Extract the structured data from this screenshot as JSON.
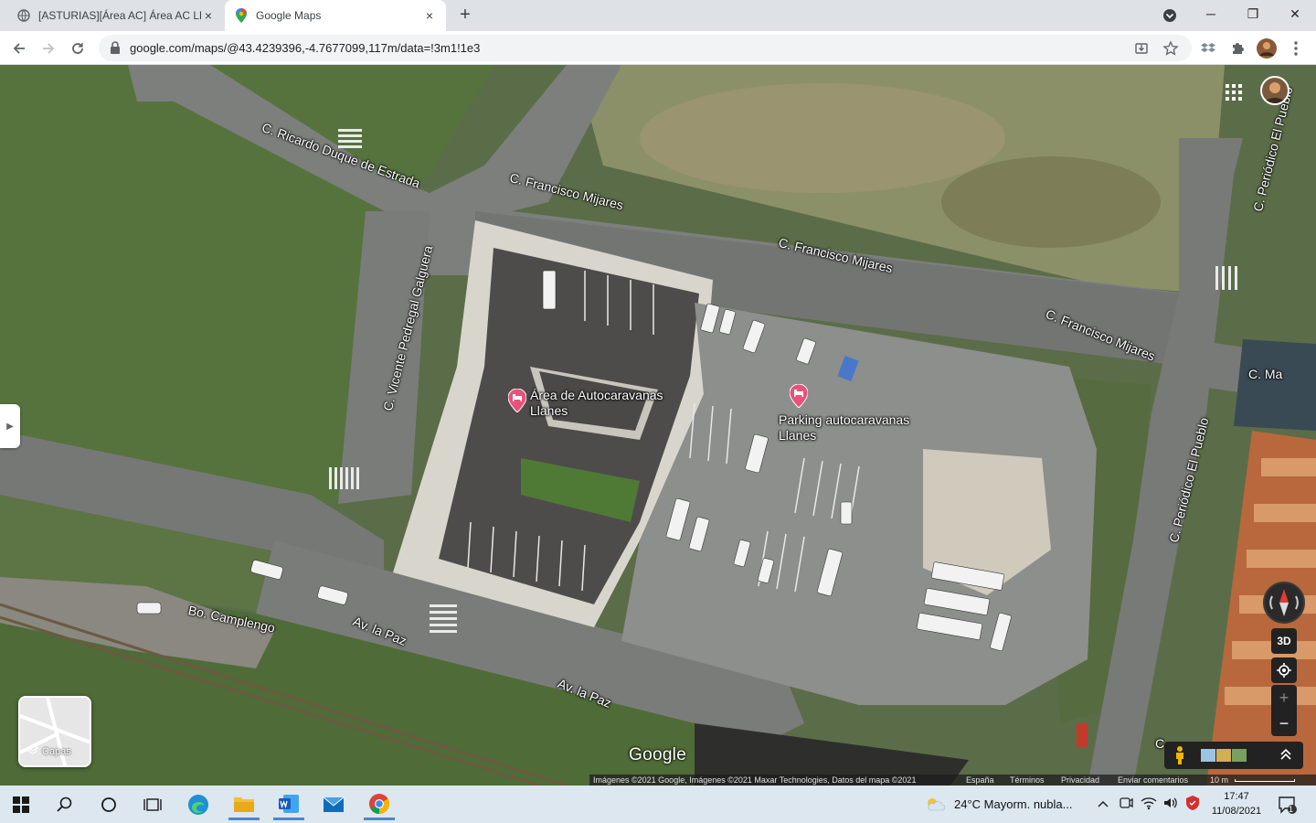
{
  "browser": {
    "tabs": [
      {
        "title": "[ASTURIAS][Área AC] Área AC Lla",
        "close": "×"
      },
      {
        "title": "Google Maps",
        "close": "×"
      }
    ],
    "new_tab": "+",
    "url": "google.com/maps/@43.4239396,-4.7677099,117m/data=!3m1!1e3",
    "window_controls": {
      "minimize": "─",
      "restore": "❐",
      "close": "✕"
    }
  },
  "map": {
    "streets": [
      {
        "label": "C. Ricardo Duque de Estrada"
      },
      {
        "label": "C. Francisco Mijares"
      },
      {
        "label": "C. Francisco Mijares"
      },
      {
        "label": "C. Francisco Mijares"
      },
      {
        "label": "C. Vicente Pedregal Galguera"
      },
      {
        "label": "C. Periódico El Pueblo"
      },
      {
        "label": "C. Periódico El Pueblo"
      },
      {
        "label": "Bo. Camplengo"
      },
      {
        "label": "Av. la Paz"
      },
      {
        "label": "Av. la Paz"
      },
      {
        "label": "C. Ma"
      },
      {
        "label": "C"
      }
    ],
    "places": [
      {
        "name": "Área de Autocaravanas Llanes",
        "icon": "bed-pin-icon",
        "color": "#e8527a"
      },
      {
        "name": "Parking autocaravanas Llanes",
        "icon": "bed-pin-icon",
        "color": "#e8527a"
      }
    ],
    "layers_label": "Capas",
    "logo": "Google",
    "control_3d": "3D",
    "zoom_in": "+",
    "zoom_out": "−"
  },
  "attribution": {
    "imagery": "Imágenes ©2021 Google, Imágenes ©2021 Maxar Technologies, Datos del mapa ©2021",
    "links": [
      "España",
      "Términos",
      "Privacidad",
      "Enviar comentarios"
    ],
    "scale": "10 m"
  },
  "taskbar": {
    "weather": "24°C  Mayorm. nubla...",
    "time": "17:47",
    "date": "11/08/2021",
    "notification_count": "1"
  }
}
